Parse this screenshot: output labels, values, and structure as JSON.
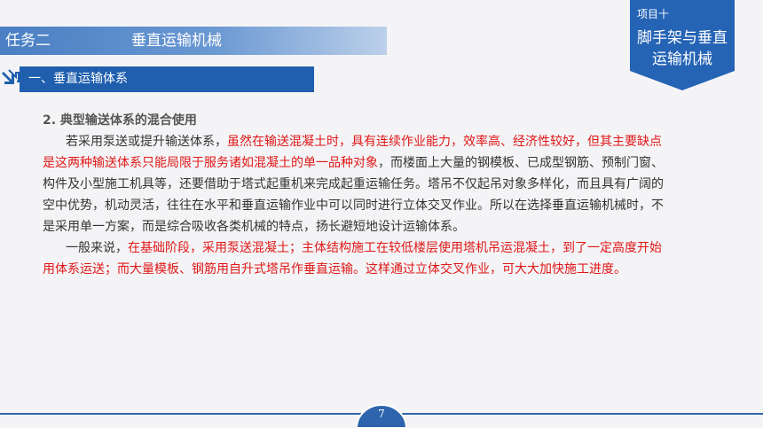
{
  "header": {
    "task": "任务二",
    "task_name": "垂直运输机械",
    "section": "一、垂直运输体系",
    "project_label": "项目十",
    "project_title": "脚手架与垂直运输机械"
  },
  "content": {
    "heading": "2. 典型输送体系的混合使用",
    "p1_a": "若采用泵送或提升输送体系，",
    "p1_red": "虽然在输送混凝土时，具有连续作业能力，效率高、经济性较好，但其主要缺点是这两种输送体系只能局限于服务诸如混凝土的单一品种对象",
    "p1_b": "，而楼面上大量的钢模板、已成型钢筋、预制门窗、构件及小型施工机具等，还要借助于塔式起重机来完成起重运输任务。塔吊不仅起吊对象多样化，而且具有广阔的空中优势，机动灵活，往往在水平和垂直运输作业中可以同时进行立体交叉作业。所以在选择垂直运输机械时，不是采用单一方案，而是综合吸收各类机械的特点，扬长避短地设计运输体系。",
    "p2_a": "一般来说，",
    "p2_red": "在基础阶段，采用泵送混凝土；主体结构施工在较低楼层使用塔机吊运混凝土，到了一定高度开始用体系运送；而大量模板、钢筋用自升式塔吊作垂直运输。这样通过立体交叉作业，可大大加快施工进度。"
  },
  "footer": {
    "page": "7"
  },
  "colors": {
    "primary": "#1f5fae",
    "accent_red": "#e01818"
  }
}
